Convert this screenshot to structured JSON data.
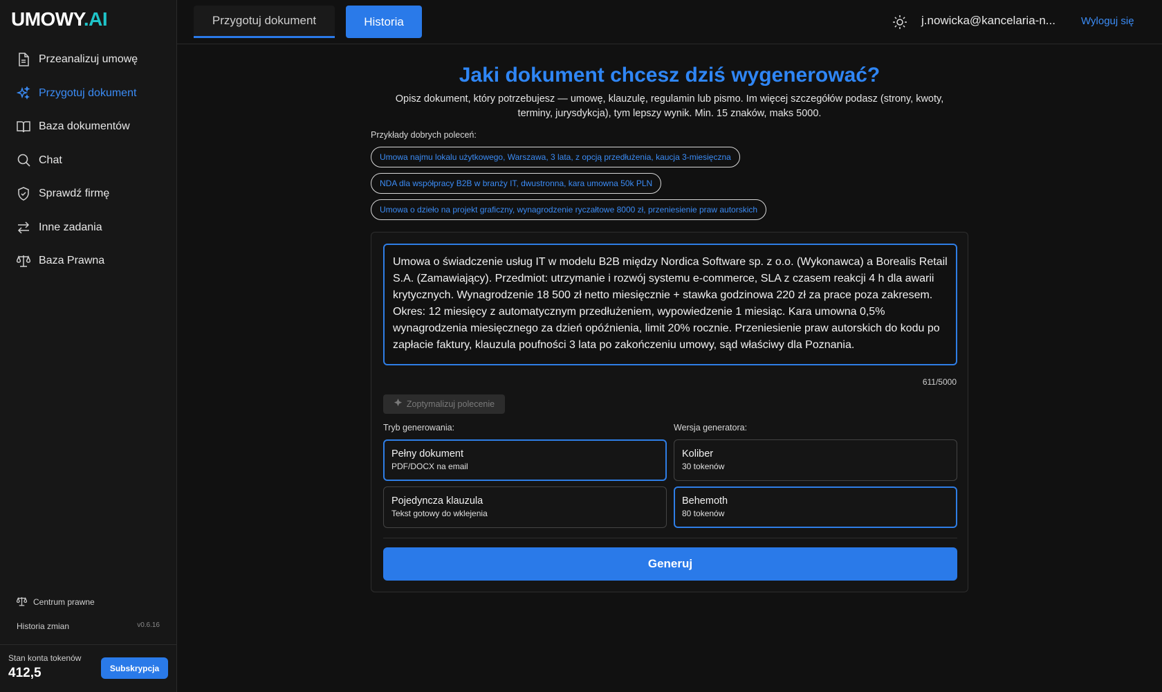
{
  "app": {
    "logo_text": "UMOWY",
    "logo_suffix": ".AI"
  },
  "sidebar": {
    "items": [
      {
        "label": "Przeanalizuj umowę",
        "icon": "document-icon",
        "active": false
      },
      {
        "label": "Przygotuj dokument",
        "icon": "sparkles-icon",
        "active": true
      },
      {
        "label": "Baza dokumentów",
        "icon": "book-icon",
        "active": false
      },
      {
        "label": "Chat",
        "icon": "search-icon",
        "active": false
      },
      {
        "label": "Sprawdź firmę",
        "icon": "shield-icon",
        "active": false
      },
      {
        "label": "Inne zadania",
        "icon": "arrows-exchange-icon",
        "active": false
      },
      {
        "label": "Baza Prawna",
        "icon": "scales-icon",
        "active": false
      }
    ],
    "legal_center": "Centrum prawne",
    "changelog": "Historia zmian",
    "version": "v0.6.16",
    "tokens_label": "Stan konta tokenów",
    "tokens_value": "412,5",
    "subscription_button": "Subskrypcja"
  },
  "topbar": {
    "tab_prepare": "Przygotuj dokument",
    "tab_history": "Historia",
    "user_email": "j.nowicka@kancelaria-n...",
    "logout": "Wyloguj się"
  },
  "main": {
    "heading": "Jaki dokument chcesz dziś wygenerować?",
    "subtitle": "Opisz dokument, który potrzebujesz — umowę, klauzulę, regulamin lub pismo. Im więcej szczegółów podasz (strony, kwoty, terminy, jurysdykcja), tym lepszy wynik. Min. 15 znaków, maks 5000.",
    "examples_label": "Przykłady dobrych poleceń:",
    "examples": [
      "Umowa najmu lokalu użytkowego, Warszawa, 3 lata, z opcją przedłużenia, kaucja 3-miesięczna",
      "NDA dla współpracy B2B w branży IT, dwustronna, kara umowna 50k PLN",
      "Umowa o dzieło na projekt graficzny, wynagrodzenie ryczałtowe 8000 zł, przeniesienie praw autorskich"
    ],
    "prompt_text": "Umowa o świadczenie usług IT w modelu B2B między Nordica Software sp. z o.o. (Wykonawca) a Borealis Retail S.A. (Zamawiający). Przedmiot: utrzymanie i rozwój systemu e-commerce, SLA z czasem reakcji 4 h dla awarii krytycznych. Wynagrodzenie 18 500 zł netto miesięcznie + stawka godzinowa 220 zł za prace poza zakresem. Okres: 12 miesięcy z automatycznym przedłużeniem, wypowiedzenie 1 miesiąc. Kara umowna 0,5% wynagrodzenia miesięcznego za dzień opóźnienia, limit 20% rocznie. Przeniesienie praw autorskich do kodu po zapłacie faktury, klauzula poufności 3 lata po zakończeniu umowy, sąd właściwy dla Poznania.",
    "char_counter": "611/5000",
    "optimize_button": "Zoptymalizuj polecenie",
    "mode_label": "Tryb generowania:",
    "version_label": "Wersja generatora:",
    "modes": [
      {
        "title": "Pełny dokument",
        "desc": "PDF/DOCX na email",
        "selected": true
      },
      {
        "title": "Pojedyncza klauzula",
        "desc": "Tekst gotowy do wklejenia",
        "selected": false
      }
    ],
    "versions": [
      {
        "title": "Koliber",
        "desc": "30 tokenów",
        "selected": false
      },
      {
        "title": "Behemoth",
        "desc": "80 tokenów",
        "selected": true
      }
    ],
    "generate_button": "Generuj"
  },
  "colors": {
    "accent": "#2a7ae9",
    "heading": "#2f86f5",
    "background": "#111111",
    "sidebar": "#171717"
  }
}
